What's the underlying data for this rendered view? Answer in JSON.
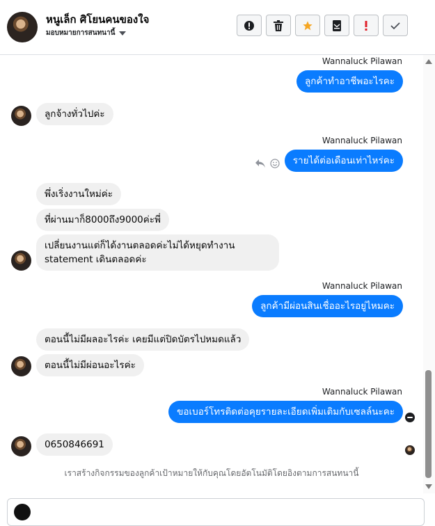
{
  "header": {
    "contact_name": "หนูเล็ก ศิโยนคนของใจ",
    "assign_label": "มอบหมายการสนทนานี้",
    "toolbar": [
      {
        "name": "report-spam-button",
        "icon": "alert-circle-icon"
      },
      {
        "name": "delete-button",
        "icon": "trash-icon"
      },
      {
        "name": "star-button",
        "icon": "star-icon"
      },
      {
        "name": "mark-unread-button",
        "icon": "envelope-icon"
      },
      {
        "name": "mark-important-button",
        "icon": "exclamation-icon"
      },
      {
        "name": "mark-done-button",
        "icon": "check-icon"
      }
    ]
  },
  "thread": {
    "sender_name": "Wannaluck Pilawan",
    "messages": [
      {
        "dir": "out",
        "text": "ลูกค้าทำอาชีพอะไรคะ"
      },
      {
        "dir": "in",
        "text": "ลูกจ้างทั่วไปค่ะ"
      },
      {
        "dir": "out",
        "text": "รายได้ต่อเดือนเท่าไหร่คะ"
      },
      {
        "dir": "in",
        "text": "พึ่งเริ่งงานใหม่ค่ะ"
      },
      {
        "dir": "in",
        "text": "ที่ผ่านมาก็8000ถึง9000ค่ะพี่"
      },
      {
        "dir": "in",
        "text": "เปลี่ยนงานแต่ก็ได้งานตลอดค่ะไม่ได้หยุดทำงาน statement เดินตลอดค่ะ"
      },
      {
        "dir": "out",
        "text": "ลูกค้ามีผ่อนสินเชื่ออะไรอยู่ไหมคะ"
      },
      {
        "dir": "in",
        "text": "ตอนนี้ไม่มีผลอะไรค่ะ เคยมีแต่ปิดบัตรไปหมดแล้ว"
      },
      {
        "dir": "in",
        "text": "ตอนนี้ไม่มีผ่อนอะไรค่ะ"
      },
      {
        "dir": "out",
        "text": "ขอเบอร์โทรติดต่อคุยรายละเอียดเพิ่มเติมกับเซลล์นะคะ"
      },
      {
        "dir": "in",
        "text": "0650846691"
      }
    ],
    "footer_note": "เราสร้างกิจกรรมของลูกค้าเป้าหมายให้กับคุณโดยอัตโนมัติโดยอิงตามการสนทนานี้"
  },
  "colors": {
    "outgoing_bubble": "#0a7cff",
    "incoming_bubble": "#f0f0f0",
    "star": "#f5a623"
  }
}
